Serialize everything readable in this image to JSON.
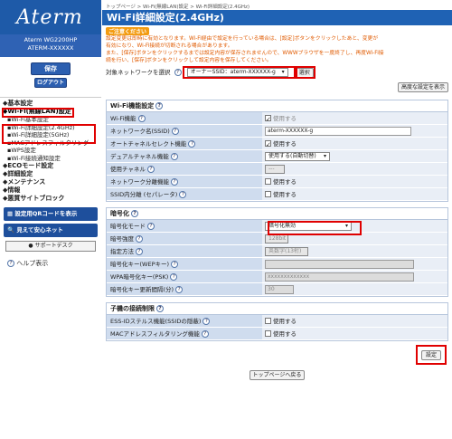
{
  "sidebar": {
    "logo": "Aterm",
    "model_line1": "Aterm  WG2200HP",
    "model_line2": "ATERM-XXXXXX",
    "save_label": "保存",
    "logout_label": "ログアウト",
    "nav": [
      {
        "label": "◆基本設定",
        "type": "item"
      },
      {
        "label": "◆Wi-Fi(無線LAN)設定",
        "type": "item"
      },
      {
        "label": "▪Wi-Fi基本設定",
        "type": "sub"
      },
      {
        "label": "▪Wi-Fi詳細設定(2.4GHz)",
        "type": "sub"
      },
      {
        "label": "▪Wi-Fi詳細設定(5GHz)",
        "type": "sub"
      },
      {
        "label": "▪MACアドレスフィルタリング",
        "type": "sub"
      },
      {
        "label": "▪WPS設定",
        "type": "sub"
      },
      {
        "label": "▪Wi-Fi接続通知設定",
        "type": "sub"
      },
      {
        "label": "◆ECOモード設定",
        "type": "item"
      },
      {
        "label": "◆詳細設定",
        "type": "item"
      },
      {
        "label": "◆メンテナンス",
        "type": "item"
      },
      {
        "label": "◆情報",
        "type": "item"
      },
      {
        "label": "◆悪質サイトブロック",
        "type": "item"
      }
    ],
    "qr_button": "設定用QRコードを表示",
    "anshin_button": "見えて安心ネット",
    "support_button": "サポートデスク",
    "help_label": "ヘルプ表示"
  },
  "main": {
    "breadcrumb": "トップページ > Wi-Fi(無線LAN)設定 > Wi-Fi詳細設定(2.4GHz)",
    "title": "Wi-Fi詳細設定(2.4GHz)",
    "notice_head": "ご注意ください",
    "notice_lines": [
      "設定変更は即時に有効となります。Wi-Fi経由で設定を行っている場合は、[設定]ボタンをクリックしたあと、変更が",
      "有効になり、Wi-Fi接続が切断される場合があります。",
      "また、[保存]ボタンをクリックするまでは設定内容が保存されませんので、WWWブラウザを一度終了し、再度Wi-Fi接",
      "続を行い、[保存]ボタンをクリックして設定内容を保存してください。"
    ],
    "target_label": "対象ネットワークを選択",
    "target_value": "オーナーSSID：aterm-XXXXXX-g",
    "select_button": "選択",
    "advanced_button": "高度な設定を表示",
    "wifi_section": {
      "title": "Wi-Fi機能設定",
      "rows": [
        {
          "label": "Wi-Fi機能",
          "value": "使用する"
        },
        {
          "label": "ネットワーク名(SSID)",
          "value": "aterm-XXXXXX-g"
        },
        {
          "label": "オートチャネルセレクト機能",
          "value": "使用する"
        },
        {
          "label": "デュアルチャネル機能",
          "value": "使用する(自動切替)"
        },
        {
          "label": "使用チャネル",
          "value": "---"
        },
        {
          "label": "ネットワーク分離機能",
          "value": "使用する"
        },
        {
          "label": "SSID内分離 (セパレータ)",
          "value": "使用する"
        }
      ]
    },
    "enc_section": {
      "title": "暗号化",
      "rows": [
        {
          "label": "暗号化モード",
          "value": "暗号化無効"
        },
        {
          "label": "暗号強度",
          "value": "128bit"
        },
        {
          "label": "指定方法",
          "value": "英数字(13桁)"
        },
        {
          "label": "暗号化キー(WEPキー)",
          "value": ""
        },
        {
          "label": "WPA暗号化キー(PSK)",
          "value": "xxxxxxxxxxxxx"
        },
        {
          "label": "暗号化キー更新間隔(分)",
          "value": "30"
        }
      ]
    },
    "child_section": {
      "title": "子機の接続制限",
      "rows": [
        {
          "label": "ESS-IDステルス機能(SSIDの隠蔽)",
          "value": "使用する"
        },
        {
          "label": "MACアドレスフィルタリング機能",
          "value": "使用する"
        }
      ]
    },
    "set_button": "設定",
    "top_button": "トップページへ戻る"
  },
  "colors": {
    "accent": "#1f62b4",
    "highlight": "#e00000",
    "notice": "#e05a00"
  }
}
